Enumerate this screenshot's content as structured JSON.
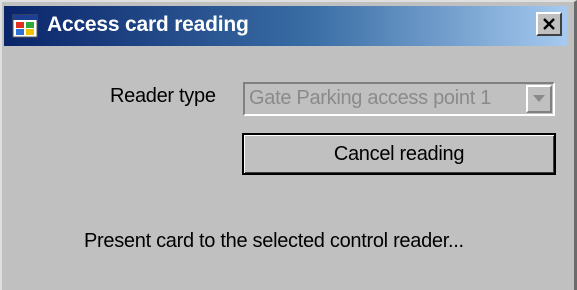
{
  "window": {
    "title": "Access card reading",
    "app_icon": "windows-app-icon",
    "close_icon": "close-x-icon",
    "colors": {
      "face": "#c0c0c0",
      "titlebar_start": "#0a246a",
      "titlebar_end": "#a6caf0",
      "disabled_text": "#8a8a8a"
    }
  },
  "form": {
    "reader_type_label": "Reader type",
    "reader_type_value": "Gate Parking access point 1",
    "reader_type_disabled": true,
    "dropdown_icon": "chevron-down-icon",
    "cancel_button_label": "Cancel reading"
  },
  "status": {
    "message": "Present card to the selected control reader..."
  }
}
